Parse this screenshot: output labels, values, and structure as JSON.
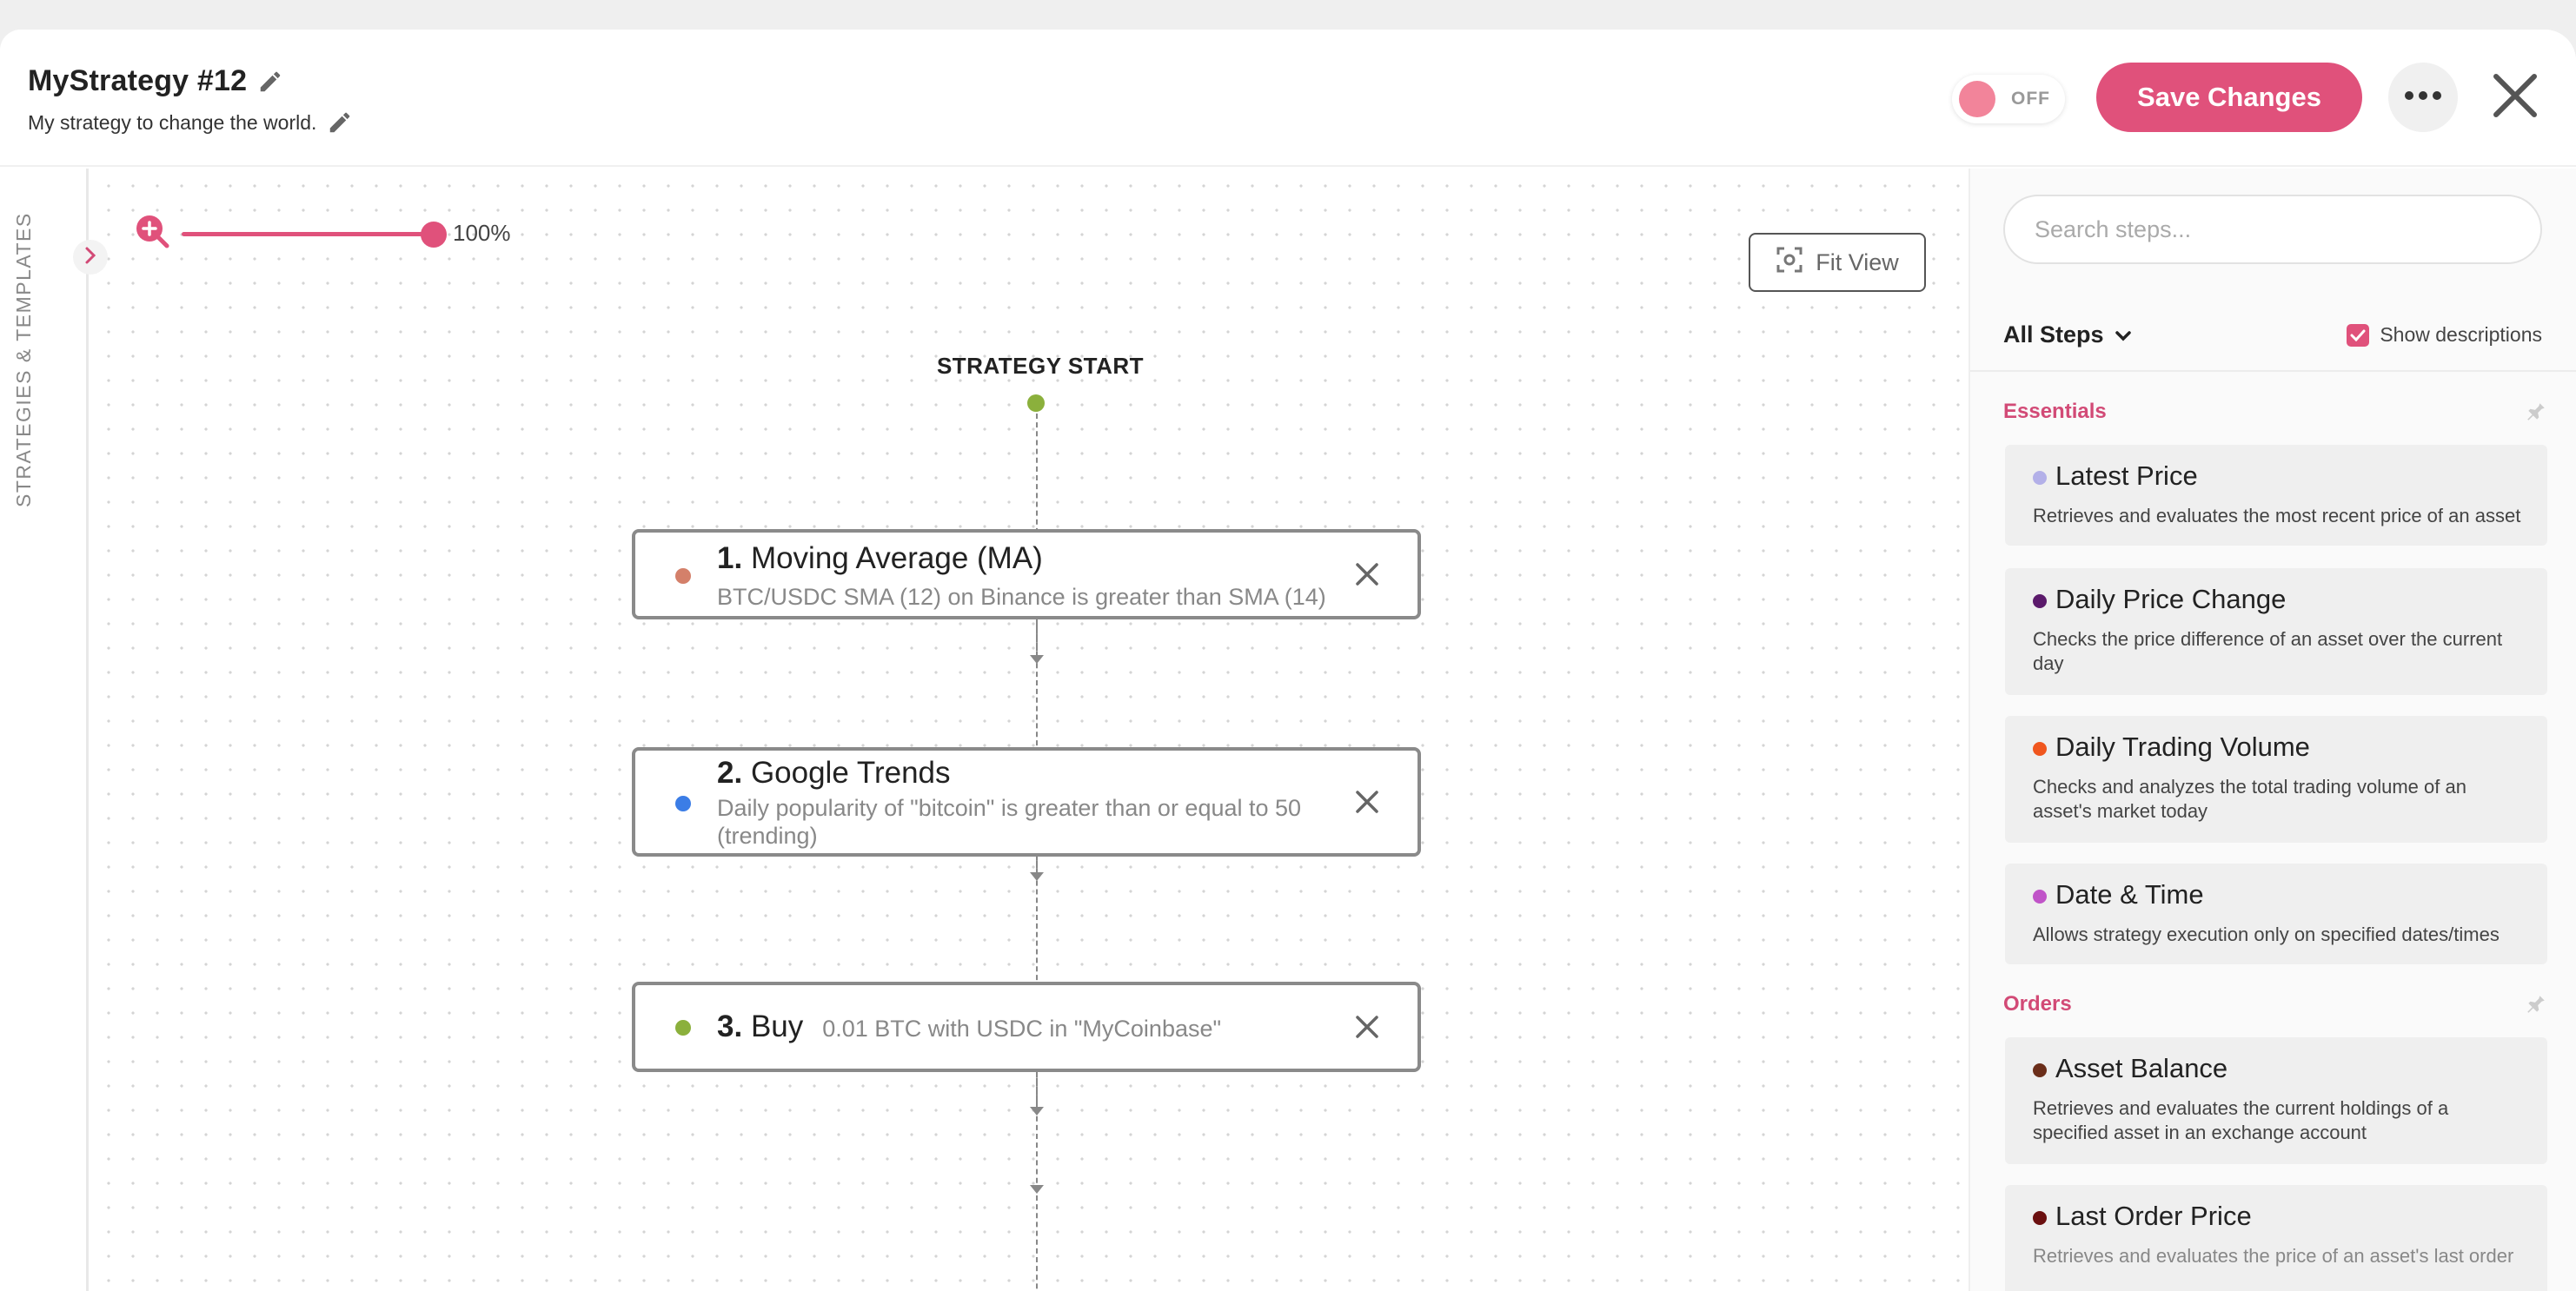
{
  "header": {
    "title": "MyStrategy #12",
    "subtitle": "My strategy to change the world.",
    "toggle_label": "OFF",
    "save_label": "Save Changes"
  },
  "rail": {
    "label": "STRATEGIES & TEMPLATES"
  },
  "canvas": {
    "zoom_value": "100%",
    "zoom_level": 1.0,
    "fit_view_label": "Fit View",
    "start_label": "STRATEGY START",
    "steps": [
      {
        "number": "1.",
        "title": "Moving Average (MA)",
        "desc": "BTC/USDC SMA (12) on Binance is greater than SMA (14)",
        "color": "#d4806a"
      },
      {
        "number": "2.",
        "title": "Google Trends",
        "desc_line1": "Daily popularity of \"bitcoin\" is greater than or equal to 50",
        "desc_line2": "(trending)",
        "color": "#3b7de6"
      },
      {
        "number": "3.",
        "title": "Buy",
        "desc": "0.01 BTC with USDC in \"MyCoinbase\"",
        "color": "#8bb03c"
      }
    ]
  },
  "panel": {
    "search_placeholder": "Search steps...",
    "filter_label": "All Steps",
    "show_descriptions_label": "Show descriptions",
    "show_descriptions_checked": true,
    "sections": [
      {
        "label": "Essentials",
        "items": [
          {
            "title": "Latest Price",
            "desc": "Retrieves and evaluates the most recent price of an asset",
            "color": "#b3b0e8"
          },
          {
            "title": "Daily Price Change",
            "desc_line1": "Checks the price difference of an asset over the current",
            "desc_line2": "day",
            "color": "#5b1a6b"
          },
          {
            "title": "Daily Trading Volume",
            "desc_line1": "Checks and analyzes the total trading volume of an",
            "desc_line2": "asset's market today",
            "color": "#f0561e"
          },
          {
            "title": "Date & Time",
            "desc": "Allows strategy execution only on specified dates/times",
            "color": "#c054c8"
          }
        ]
      },
      {
        "label": "Orders",
        "items": [
          {
            "title": "Asset Balance",
            "desc_line1": "Retrieves and evaluates the current holdings of a",
            "desc_line2": "specified asset in an exchange account",
            "color": "#6b2e1a"
          },
          {
            "title": "Last Order Price",
            "desc": "Retrieves and evaluates the price of an asset's last order",
            "color": "#6b1010"
          }
        ]
      }
    ]
  }
}
